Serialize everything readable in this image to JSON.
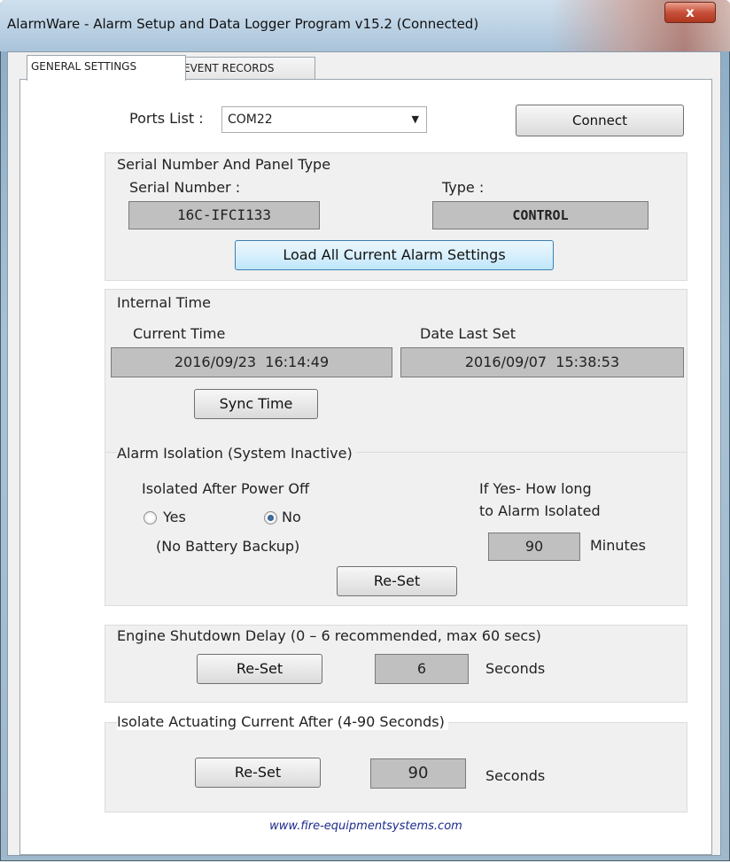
{
  "window": {
    "title": "AlarmWare - Alarm Setup and Data Logger Program v15.2 (Connected)",
    "close_label": "x"
  },
  "tabs": [
    {
      "label": "GENERAL SETTINGS",
      "active": true
    },
    {
      "label": "EVENT RECORDS",
      "active": false
    }
  ],
  "ports": {
    "label": "Ports List :",
    "selected": "COM22",
    "connect_label": "Connect"
  },
  "serial_group": {
    "title": "Serial Number And Panel Type",
    "serial_label": "Serial Number :",
    "serial_value": "16C-IFCI133",
    "type_label": "Type :",
    "type_value": "CONTROL",
    "load_label": "Load All Current Alarm Settings"
  },
  "time_group": {
    "title": "Internal Time",
    "current_label": "Current Time",
    "current_value": "2016/09/23  16:14:49",
    "last_set_label": "Date Last Set",
    "last_set_value": "2016/09/07  15:38:53",
    "sync_label": "Sync Time"
  },
  "isolation_group": {
    "title": "Alarm Isolation (System Inactive)",
    "power_off_label": "Isolated After Power Off",
    "yes_label": "Yes",
    "no_label": "No",
    "selected": "No",
    "battery_note": "(No Battery Backup)",
    "how_long_label_1": "If Yes- How long",
    "how_long_label_2": "to Alarm Isolated",
    "minutes_value": "90",
    "minutes_unit": "Minutes",
    "reset_label": "Re-Set"
  },
  "shutdown_group": {
    "title": "Engine Shutdown Delay (0 – 6 recommended, max 60 secs)",
    "reset_label": "Re-Set",
    "value": "6",
    "unit": "Seconds"
  },
  "actuating_group": {
    "title": "Isolate Actuating Current After (4-90 Seconds)",
    "reset_label": "Re-Set",
    "value": "90",
    "unit": "Seconds"
  },
  "footer": {
    "link": "www.fire-equipmentsystems.com"
  }
}
